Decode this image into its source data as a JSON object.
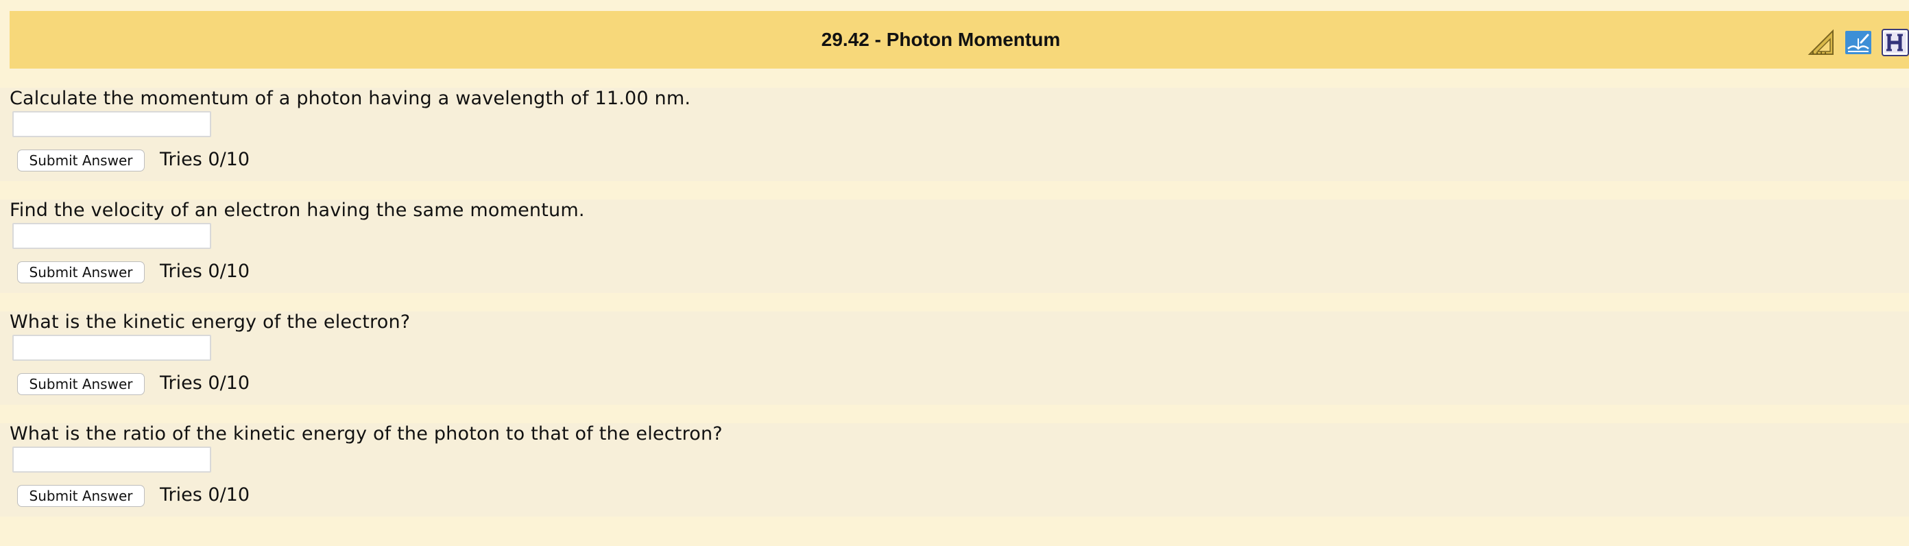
{
  "header": {
    "title": "29.42 - Photon Momentum",
    "icons": [
      "triangle-ruler-icon",
      "book-feedback-icon",
      "help-h-icon"
    ],
    "background": "#f7d87a"
  },
  "parts": [
    {
      "question": "Calculate the momentum of a photon having a wavelength of 11.00 nm.",
      "answer_value": "",
      "submit_label": "Submit Answer",
      "tries": "Tries 0/10"
    },
    {
      "question": "Find the velocity of an electron having the same momentum.",
      "answer_value": "",
      "submit_label": "Submit Answer",
      "tries": "Tries 0/10"
    },
    {
      "question": "What is the kinetic energy of the electron?",
      "answer_value": "",
      "submit_label": "Submit Answer",
      "tries": "Tries 0/10"
    },
    {
      "question": "What is the ratio of the kinetic energy of the photon to that of the electron?",
      "answer_value": "",
      "submit_label": "Submit Answer",
      "tries": "Tries 0/10"
    }
  ],
  "colors": {
    "page_background": "#fcf3d6",
    "part_background": "#f7efd9"
  }
}
